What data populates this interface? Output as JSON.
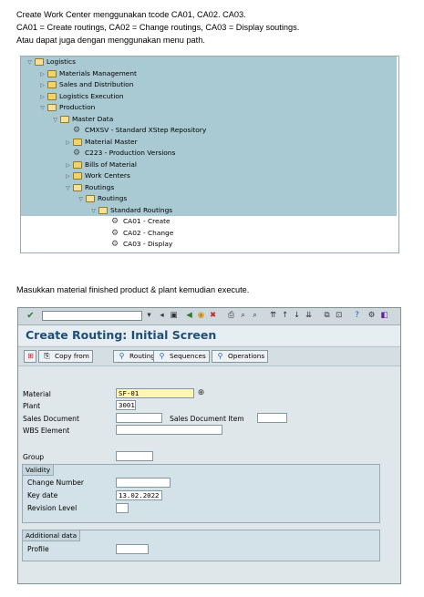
{
  "intro_lines": [
    "Create Work Center menggunakan tcode CA01, CA02. CA03.",
    "CA01 = Create routings, CA02 = Change routings, CA03 = Display soutings.",
    "Atau dapat juga dengan menggunakan menu path."
  ],
  "tree": [
    {
      "label": "Logistics",
      "level": 0,
      "type": "folder",
      "open": true,
      "highlight": true
    },
    {
      "label": "Materials Management",
      "level": 1,
      "type": "folder",
      "open": false,
      "highlight": true
    },
    {
      "label": "Sales and Distribution",
      "level": 1,
      "type": "folder",
      "open": false,
      "highlight": true
    },
    {
      "label": "Logistics Execution",
      "level": 1,
      "type": "folder",
      "open": false,
      "highlight": true
    },
    {
      "label": "Production",
      "level": 1,
      "type": "folder",
      "open": true,
      "highlight": true
    },
    {
      "label": "Master Data",
      "level": 2,
      "type": "folder",
      "open": true,
      "highlight": true
    },
    {
      "label": "CMXSV - Standard XStep Repository",
      "level": 3,
      "type": "transaction",
      "highlight": true
    },
    {
      "label": "Material Master",
      "level": 3,
      "type": "folder",
      "open": false,
      "highlight": true
    },
    {
      "label": "C223 - Production Versions",
      "level": 3,
      "type": "transaction",
      "highlight": true
    },
    {
      "label": "Bills of Material",
      "level": 3,
      "type": "folder",
      "open": false,
      "highlight": true
    },
    {
      "label": "Work Centers",
      "level": 3,
      "type": "folder",
      "open": false,
      "highlight": true
    },
    {
      "label": "Routings",
      "level": 3,
      "type": "folder",
      "open": true,
      "highlight": true
    },
    {
      "label": "Routings",
      "level": 4,
      "type": "folder",
      "open": true,
      "highlight": true
    },
    {
      "label": "Standard Routings",
      "level": 5,
      "type": "folder",
      "open": true,
      "highlight": true
    },
    {
      "label": "CA01 - Create",
      "level": 6,
      "type": "transaction",
      "highlight": false
    },
    {
      "label": "CA02 - Change",
      "level": 6,
      "type": "transaction",
      "highlight": false
    },
    {
      "label": "CA03 - Display",
      "level": 6,
      "type": "transaction",
      "highlight": false
    }
  ],
  "instruction": "Masukkan material finished product & plant kemudian execute.",
  "sap": {
    "title": "Create Routing: Initial Screen",
    "toolbar_buttons": [
      {
        "label": "",
        "icon": "hierarchy-icon"
      },
      {
        "label": "Copy from",
        "icon": "copy-icon"
      },
      {
        "label": "Routings",
        "icon": "routings-icon"
      },
      {
        "label": "Sequences",
        "icon": "sequences-icon"
      },
      {
        "label": "Operations",
        "icon": "operations-icon"
      }
    ],
    "fields": {
      "material_label": "Material",
      "material_value": "SF-01",
      "plant_label": "Plant",
      "plant_value": "3001",
      "sales_doc_label": "Sales Document",
      "sales_doc_item_label": "Sales Document Item",
      "wbs_label": "WBS Element",
      "group_label": "Group"
    },
    "validity": {
      "title": "Validity",
      "change_number_label": "Change Number",
      "key_date_label": "Key date",
      "key_date_value": "13.02.2022",
      "revision_level_label": "Revision Level"
    },
    "additional": {
      "title": "Additional data",
      "profile_label": "Profile"
    }
  }
}
